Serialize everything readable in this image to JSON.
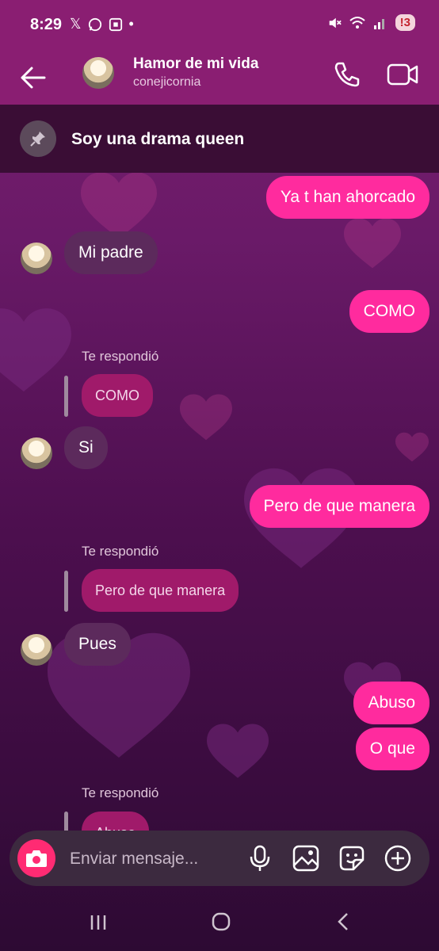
{
  "status_bar": {
    "time": "8:29",
    "left_icons": [
      "x-icon",
      "whatsapp-icon",
      "screen-record-icon",
      "dot-icon"
    ],
    "right_icons": [
      "mute-icon",
      "wifi-icon",
      "signal-icon"
    ],
    "alert_badge": "!3"
  },
  "header": {
    "contact_name": "Hamor de mi vida",
    "contact_username": "conejicornia",
    "icons": [
      "back-arrow-icon",
      "phone-icon",
      "video-camera-icon"
    ]
  },
  "pinned": {
    "text": "Soy una drama queen",
    "icon": "pin-icon"
  },
  "messages": [
    {
      "dir": "out",
      "text": "Ya t han ahorcado"
    },
    {
      "dir": "in",
      "text": "Mi padre"
    },
    {
      "dir": "out",
      "text": "COMO"
    },
    {
      "dir": "reply",
      "label": "Te respondió",
      "text": "COMO"
    },
    {
      "dir": "in",
      "text": "Si"
    },
    {
      "dir": "out",
      "text": "Pero de que manera"
    },
    {
      "dir": "reply",
      "label": "Te respondió",
      "text": "Pero de que manera"
    },
    {
      "dir": "in",
      "text": "Pues"
    },
    {
      "dir": "out",
      "text": "Abuso"
    },
    {
      "dir": "out",
      "text": "O que"
    },
    {
      "dir": "reply",
      "label": "Te respondió",
      "text": "Abuso"
    }
  ],
  "composer": {
    "placeholder": "Enviar mensaje...",
    "icons": [
      "camera-icon",
      "microphone-icon",
      "gallery-icon",
      "sticker-icon",
      "plus-icon"
    ]
  },
  "colors": {
    "outgoing_bubble": "#ff2b9e",
    "incoming_bubble": "#5c2a5c",
    "reply_bubble": "#a01a6a",
    "header_bg": "#8a1e72",
    "camera_button": "#ff2b73"
  }
}
